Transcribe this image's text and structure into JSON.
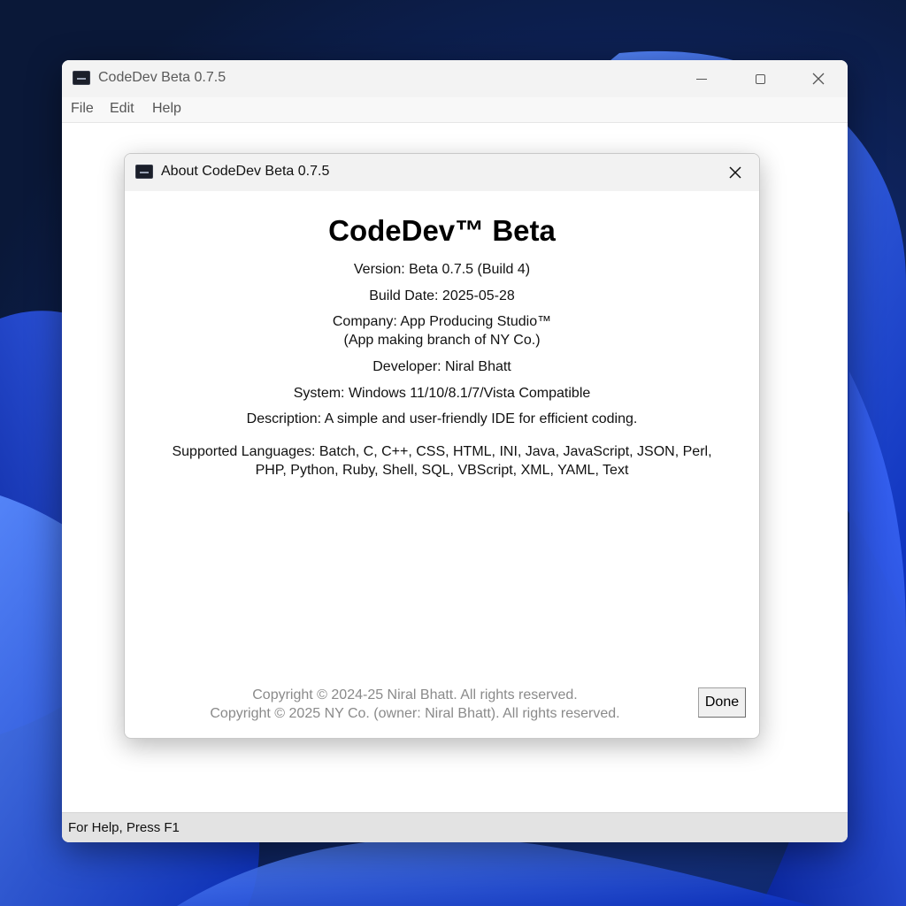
{
  "main_window": {
    "title": "CodeDev Beta 0.7.5",
    "menu": [
      "File",
      "Edit",
      "Help"
    ],
    "status": "For Help, Press F1"
  },
  "dialog": {
    "title": "About CodeDev Beta 0.7.5",
    "app_name": "CodeDev™ Beta",
    "version": "Version: Beta 0.7.5 (Build 4)",
    "build_date": "Build Date: 2025-05-28",
    "company_line1": "Company: App Producing Studio™",
    "company_line2": "(App making branch of NY Co.)",
    "developer": "Developer: Niral Bhatt",
    "system": "System: Windows 11/10/8.1/7/Vista Compatible",
    "description": "Description: A simple and user-friendly IDE for efficient coding.",
    "languages_line1": "Supported Languages: Batch, C, C++, CSS, HTML, INI, Java, JavaScript, JSON, Perl,",
    "languages_line2": "PHP, Python, Ruby, Shell, SQL, VBScript, XML, YAML, Text",
    "copyright1": "Copyright © 2024-25 Niral Bhatt. All rights reserved.",
    "copyright2": "Copyright © 2025 NY Co. (owner: Niral Bhatt). All rights reserved.",
    "done_label": "Done"
  },
  "icons": {
    "app": "app-icon",
    "minimize": "minimize-icon",
    "maximize": "maximize-icon",
    "close": "close-icon"
  },
  "colors": {
    "wallpaper_dark": "#0b1a3a",
    "wallpaper_blue": "#1f4fe0",
    "titlebar": "#f3f3f3",
    "statusbar": "#e3e3e3",
    "copyright_text": "#8a8a8a"
  }
}
